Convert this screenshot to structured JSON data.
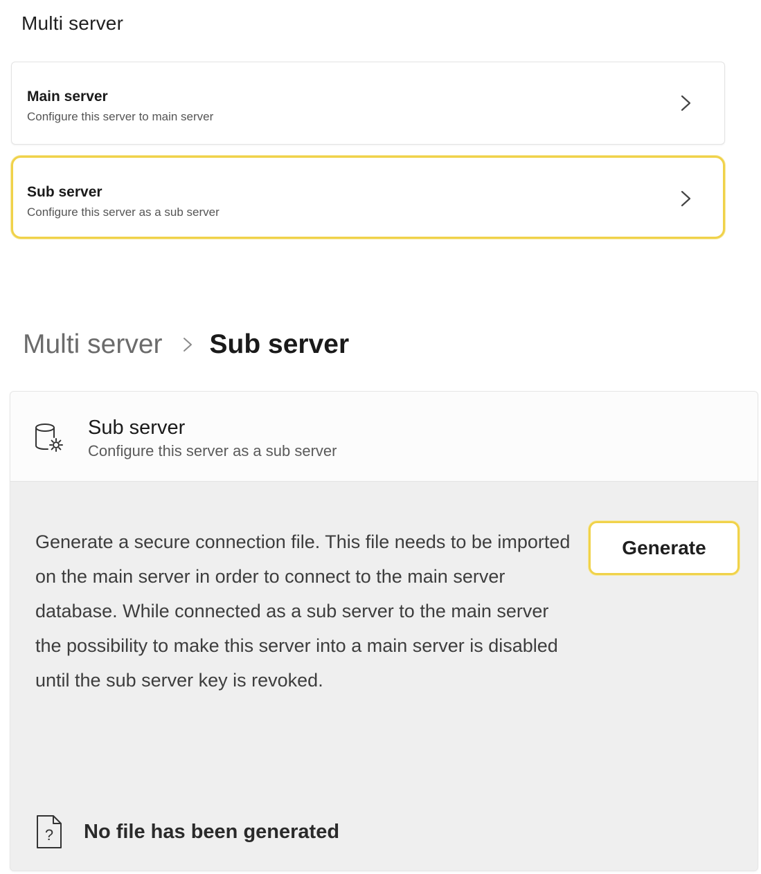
{
  "top_section": {
    "title": "Multi server",
    "items": [
      {
        "title": "Main server",
        "subtitle": "Configure this server to main server",
        "icon": "chevron-right-icon",
        "highlighted": false
      },
      {
        "title": "Sub server",
        "subtitle": "Configure this server as a sub server",
        "icon": "chevron-right-icon",
        "highlighted": true
      }
    ]
  },
  "breadcrumb": {
    "parent": "Multi server",
    "separator_icon": "chevron-right-icon",
    "current": "Sub server"
  },
  "panel": {
    "icon": "database-settings-icon",
    "title": "Sub server",
    "subtitle": "Configure this server as a sub server",
    "description": "Generate a secure connection file. This file needs to be imported on the main server in order to connect to the main server database. While connected as a sub server to the main server the possibility to make this server into a main server is disabled until the sub server key is revoked.",
    "generate_button": "Generate",
    "status_icon": "file-question-icon",
    "status_text": "No file has been generated"
  },
  "colors": {
    "highlight": "#f0d24a",
    "panel_background": "#efefef",
    "card_background": "#ffffff"
  }
}
